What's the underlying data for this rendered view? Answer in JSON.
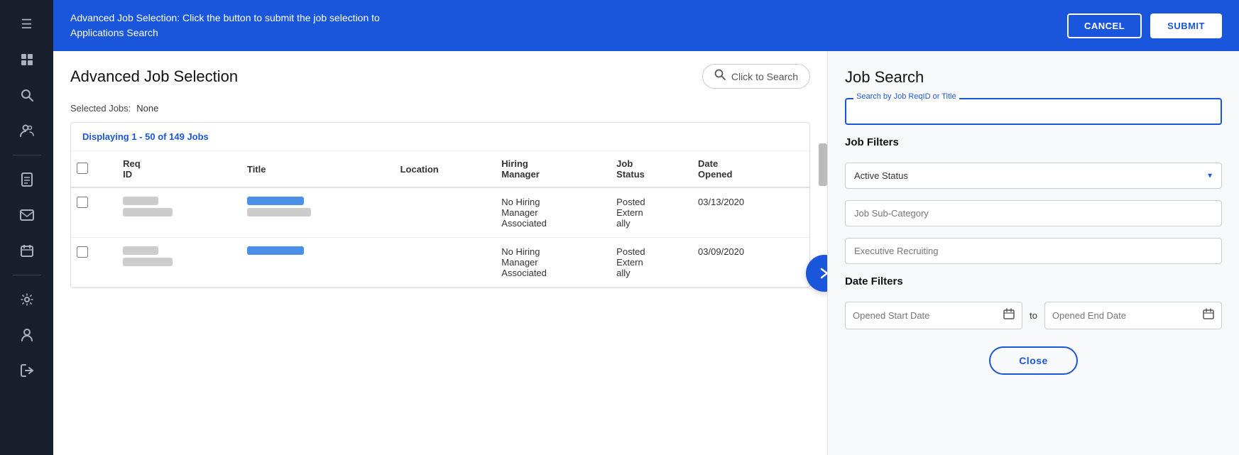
{
  "sidebar": {
    "icons": [
      {
        "name": "menu-icon",
        "symbol": "☰"
      },
      {
        "name": "grid-icon",
        "symbol": "⊞"
      },
      {
        "name": "search-icon",
        "symbol": "🔍"
      },
      {
        "name": "people-icon",
        "symbol": "👥"
      },
      {
        "name": "document-icon",
        "symbol": "📄"
      },
      {
        "name": "envelope-icon",
        "symbol": "✉"
      },
      {
        "name": "calendar-icon",
        "symbol": "📅"
      },
      {
        "name": "gear-icon",
        "symbol": "⚙"
      },
      {
        "name": "person-icon",
        "symbol": "👤"
      },
      {
        "name": "signout-icon",
        "symbol": "➜"
      }
    ]
  },
  "banner": {
    "text": "Advanced Job Selection: Click the button to submit the job selection to Applications Search",
    "cancel_label": "CANCEL",
    "submit_label": "SUBMIT"
  },
  "page": {
    "title": "Advanced Job Selection",
    "search_placeholder": "Click to Search",
    "selected_jobs_label": "Selected Jobs:",
    "selected_jobs_value": "None",
    "displaying_prefix": "Displaying",
    "displaying_range": "1 - 50 of 149",
    "displaying_suffix": "Jobs"
  },
  "table": {
    "columns": [
      {
        "label": "Req ID"
      },
      {
        "label": "Title"
      },
      {
        "label": "Location"
      },
      {
        "label": "Hiring Manager"
      },
      {
        "label": "Job Status"
      },
      {
        "label": "Date Opened"
      }
    ],
    "rows": [
      {
        "hiring_manager": "No Hiring Manager Associated",
        "job_status": "Posted Externally",
        "date_opened": "03/13/2020"
      },
      {
        "hiring_manager": "No Hiring Manager Associated",
        "job_status": "Posted Externally",
        "date_opened": "03/09/2020"
      }
    ]
  },
  "job_search": {
    "title": "Job Search",
    "search_label": "Search by Job ReqID or Title",
    "search_value": "",
    "filters_title": "Job Filters",
    "active_status_placeholder": "Active Status",
    "job_subcategory_placeholder": "Job Sub-Category",
    "executive_recruiting_placeholder": "Executive Recruiting",
    "date_filters_title": "Date Filters",
    "opened_start_placeholder": "Opened Start Date",
    "opened_end_placeholder": "Opened End Date",
    "to_label": "to",
    "close_label": "Close"
  },
  "colors": {
    "primary": "#1a56db",
    "sidebar_bg": "#1a1f2e",
    "banner_bg": "#1a56db",
    "text_dark": "#111111",
    "text_muted": "#888888"
  }
}
